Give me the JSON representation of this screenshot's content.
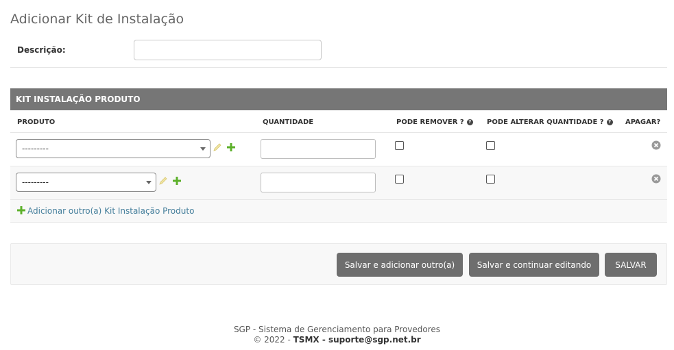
{
  "page": {
    "title": "Adicionar Kit de Instalação"
  },
  "form": {
    "description_label": "Descrição:",
    "description_value": ""
  },
  "inline": {
    "header": "KIT INSTALAÇÃO PRODUTO",
    "columns": {
      "produto": "PRODUTO",
      "quantidade": "QUANTIDADE",
      "pode_remover": "PODE REMOVER ?",
      "pode_alterar": "PODE ALTERAR QUANTIDADE ?",
      "apagar": "APAGAR?"
    },
    "rows": [
      {
        "produto": "---------",
        "quantidade": "",
        "pode_remover": false,
        "pode_alterar": false
      },
      {
        "produto": "---------",
        "quantidade": "",
        "pode_remover": false,
        "pode_alterar": false
      }
    ],
    "add_label": "Adicionar outro(a) Kit Instalação Produto"
  },
  "actions": {
    "save_add": "Salvar e adicionar outro(a)",
    "save_continue": "Salvar e continuar editando",
    "save": "SALVAR"
  },
  "footer": {
    "line1": "SGP - Sistema de Gerenciamento para Provedores",
    "line2_prefix": "© 2022 - ",
    "company": "TSMX",
    "separator": " - ",
    "email": "suporte@sgp.net.br"
  },
  "colors": {
    "header_bg": "#767676",
    "button_bg": "#6e6e6e",
    "add_icon": "#5cb02a",
    "link": "#447e9b"
  },
  "icons": {
    "edit": "pencil-icon",
    "add": "plus-icon",
    "delete": "delete-icon",
    "help": "help-icon"
  }
}
